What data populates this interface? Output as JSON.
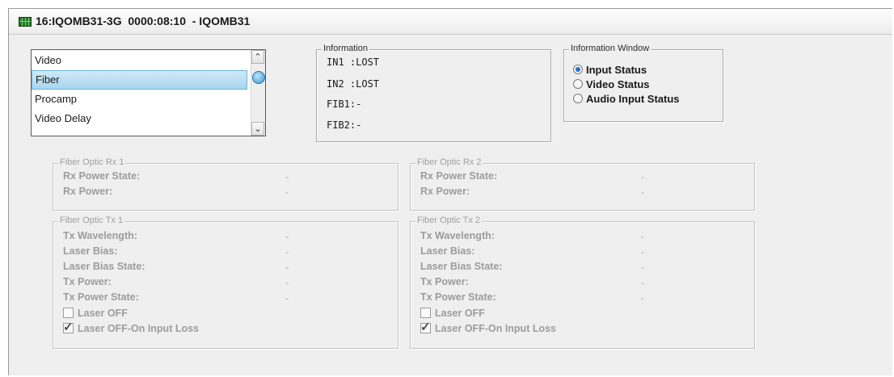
{
  "window": {
    "title": "16:IQOMB31-3G  0000:08:10  - IQOMB31"
  },
  "list": {
    "items": [
      "Video",
      "Fiber",
      "Procamp",
      "Video Delay"
    ],
    "selected_index": 1
  },
  "information": {
    "title": "Information",
    "lines": [
      "IN1 :LOST",
      "IN2 :LOST",
      "FIB1:-",
      "FIB2:-"
    ]
  },
  "information_window": {
    "title": "Information Window",
    "options": [
      "Input Status",
      "Video Status",
      "Audio Input Status"
    ],
    "selected_index": 0
  },
  "rx1": {
    "title": "Fiber Optic Rx 1",
    "fields": [
      {
        "label": "Rx Power State:",
        "value": "-"
      },
      {
        "label": "Rx Power:",
        "value": "-"
      }
    ]
  },
  "rx2": {
    "title": "Fiber Optic Rx 2",
    "fields": [
      {
        "label": "Rx Power State:",
        "value": "-"
      },
      {
        "label": "Rx Power:",
        "value": "-"
      }
    ]
  },
  "tx1": {
    "title": "Fiber Optic Tx 1",
    "fields": [
      {
        "label": "Tx Wavelength:",
        "value": "-"
      },
      {
        "label": "Laser Bias:",
        "value": "-"
      },
      {
        "label": "Laser Bias State:",
        "value": "-"
      },
      {
        "label": "Tx Power:",
        "value": "-"
      },
      {
        "label": "Tx Power State:",
        "value": "-"
      }
    ],
    "laser_off": {
      "label": "Laser OFF",
      "checked": false
    },
    "laser_off_input_loss": {
      "label": "Laser OFF-On Input Loss",
      "checked": true
    }
  },
  "tx2": {
    "title": "Fiber Optic Tx 2",
    "fields": [
      {
        "label": "Tx Wavelength:",
        "value": "-"
      },
      {
        "label": "Laser Bias:",
        "value": "-"
      },
      {
        "label": "Laser Bias State:",
        "value": "-"
      },
      {
        "label": "Tx Power:",
        "value": "-"
      },
      {
        "label": "Tx Power State:",
        "value": "-"
      }
    ],
    "laser_off": {
      "label": "Laser OFF",
      "checked": false
    },
    "laser_off_input_loss": {
      "label": "Laser OFF-On Input Loss",
      "checked": true
    }
  }
}
